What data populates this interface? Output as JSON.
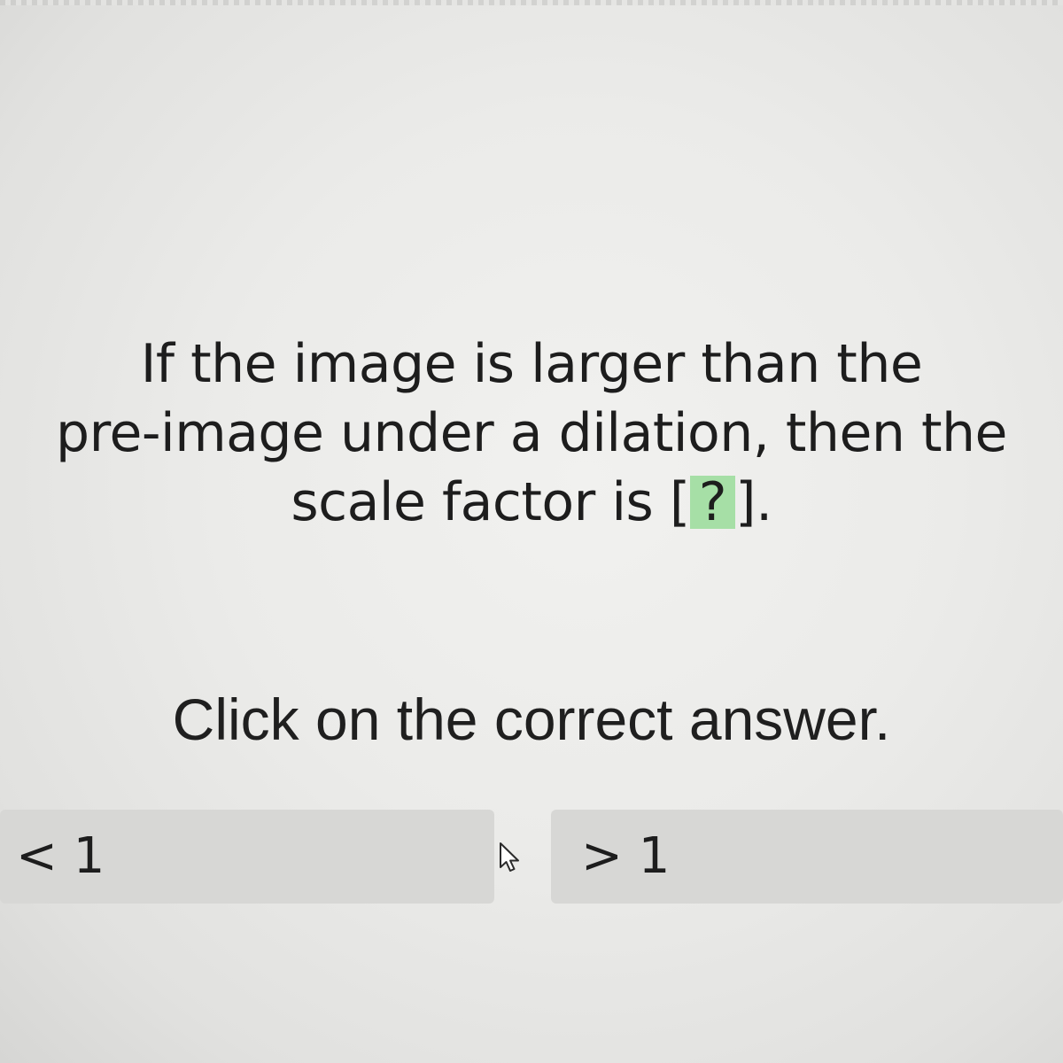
{
  "question": {
    "line1": "If the image is larger than the",
    "line2": "pre-image under a dilation, then the",
    "line3_before": "scale factor is [",
    "blank": " ? ",
    "line3_after": "]."
  },
  "instruction": "Click on the correct answer.",
  "choices": [
    {
      "label": "< 1"
    },
    {
      "label": "> 1"
    }
  ],
  "colors": {
    "blank_highlight": "#a6dfa6",
    "choice_background": "#d7d7d5"
  },
  "icons": {
    "cursor": "mouse-pointer-icon"
  }
}
